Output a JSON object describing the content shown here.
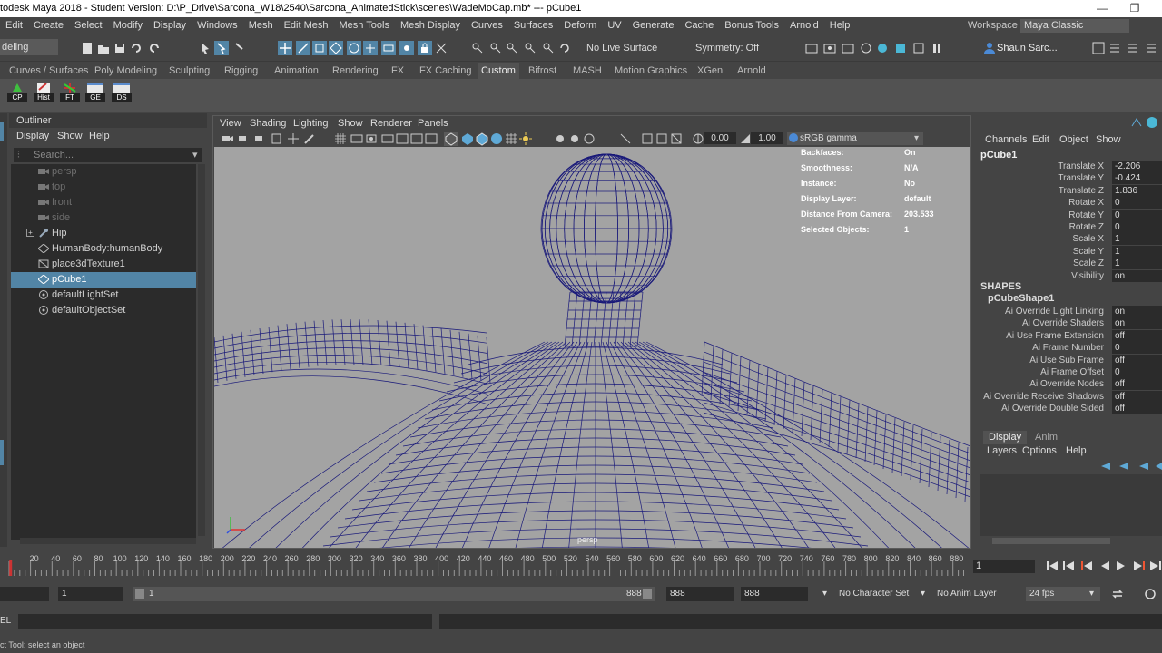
{
  "title_bar": {
    "text": "todesk Maya 2018 - Student Version: D:\\P_Drive\\Sarcona_W18\\2540\\Sarcona_AnimatedStick\\scenes\\WadeMoCap.mb*   ---   pCube1",
    "minimize_glyph": "—",
    "restore_glyph": "❐"
  },
  "menu_bar": {
    "items": [
      "Edit",
      "Create",
      "Select",
      "Modify",
      "Display",
      "Windows",
      "Mesh",
      "Edit Mesh",
      "Mesh Tools",
      "Mesh Display",
      "Curves",
      "Surfaces",
      "Deform",
      "UV",
      "Generate",
      "Cache",
      "Bonus Tools",
      "Arnold",
      "Help"
    ],
    "workspace_label": "Workspace :",
    "workspace_value": "Maya Classic"
  },
  "status_line": {
    "mode": "deling",
    "live_surface": "No Live Surface",
    "symmetry": "Symmetry: Off",
    "user": "Shaun Sarc..."
  },
  "shelf_tabs": {
    "items": [
      "Curves / Surfaces",
      "Poly Modeling",
      "Sculpting",
      "Rigging",
      "Animation",
      "Rendering",
      "FX",
      "FX Caching",
      "Custom",
      "Bifrost",
      "MASH",
      "Motion Graphics",
      "XGen",
      "Arnold"
    ],
    "active": "Custom"
  },
  "shelf_buttons": [
    {
      "label": "CP",
      "icon": "cp-shelf-icon"
    },
    {
      "label": "Hist",
      "icon": "history-shelf-icon"
    },
    {
      "label": "FT",
      "icon": "freeze-transform-shelf-icon"
    },
    {
      "label": "GE",
      "icon": "graph-editor-shelf-icon"
    },
    {
      "label": "DS",
      "icon": "dope-sheet-shelf-icon"
    }
  ],
  "outliner": {
    "title": "Outliner",
    "menus": [
      "Display",
      "Show",
      "Help"
    ],
    "search_placeholder": "Search...",
    "items": [
      {
        "label": "persp",
        "icon": "camera-icon",
        "dim": true
      },
      {
        "label": "top",
        "icon": "camera-icon",
        "dim": true
      },
      {
        "label": "front",
        "icon": "camera-icon",
        "dim": true
      },
      {
        "label": "side",
        "icon": "camera-icon",
        "dim": true
      },
      {
        "label": "Hip",
        "icon": "joint-icon",
        "dim": false,
        "expandable": true
      },
      {
        "label": "HumanBody:humanBody",
        "icon": "mesh-icon",
        "dim": false
      },
      {
        "label": "place3dTexture1",
        "icon": "texture-placement-icon",
        "dim": false
      },
      {
        "label": "pCube1",
        "icon": "mesh-icon",
        "dim": false,
        "selected": true
      },
      {
        "label": "defaultLightSet",
        "icon": "set-icon",
        "dim": false
      },
      {
        "label": "defaultObjectSet",
        "icon": "set-icon",
        "dim": false
      }
    ]
  },
  "viewport": {
    "menus": [
      "View",
      "Shading",
      "Lighting",
      "Show",
      "Renderer",
      "Panels"
    ],
    "exposure": "0.00",
    "gamma": "1.00",
    "color_space": "sRGB gamma",
    "camera_label": "persp",
    "hud": [
      {
        "label": "Backfaces:",
        "value": "On"
      },
      {
        "label": "Smoothness:",
        "value": "N/A"
      },
      {
        "label": "Instance:",
        "value": "No"
      },
      {
        "label": "Display Layer:",
        "value": "default"
      },
      {
        "label": "Distance From Camera:",
        "value": "203.533"
      },
      {
        "label": "Selected Objects:",
        "value": "1"
      }
    ],
    "wire_color": "#1a1a7a",
    "background_color": "#a3a3a3"
  },
  "channel_box": {
    "menus": [
      "Channels",
      "Edit",
      "Object",
      "Show"
    ],
    "object": "pCube1",
    "attributes": [
      {
        "name": "Translate X",
        "value": "-2.206"
      },
      {
        "name": "Translate Y",
        "value": "-0.424"
      },
      {
        "name": "Translate Z",
        "value": "1.836"
      },
      {
        "name": "Rotate X",
        "value": "0"
      },
      {
        "name": "Rotate Y",
        "value": "0"
      },
      {
        "name": "Rotate Z",
        "value": "0"
      },
      {
        "name": "Scale X",
        "value": "1"
      },
      {
        "name": "Scale Y",
        "value": "1"
      },
      {
        "name": "Scale Z",
        "value": "1"
      },
      {
        "name": "Visibility",
        "value": "on"
      }
    ],
    "shapes_header": "SHAPES",
    "shape_name": "pCubeShape1",
    "shape_attributes": [
      {
        "name": "Ai Override Light Linking",
        "value": "on"
      },
      {
        "name": "Ai Override Shaders",
        "value": "on"
      },
      {
        "name": "Ai Use Frame Extension",
        "value": "off"
      },
      {
        "name": "Ai Frame Number",
        "value": "0"
      },
      {
        "name": "Ai Use Sub Frame",
        "value": "off"
      },
      {
        "name": "Ai Frame Offset",
        "value": "0"
      },
      {
        "name": "Ai Override Nodes",
        "value": "off"
      },
      {
        "name": "Ai Override Receive Shadows",
        "value": "off"
      },
      {
        "name": "Ai Override Double Sided",
        "value": "off"
      }
    ]
  },
  "layer_editor": {
    "tabs": [
      "Display",
      "Anim"
    ],
    "active_tab": "Display",
    "menus": [
      "Layers",
      "Options",
      "Help"
    ]
  },
  "time_slider": {
    "ticks": [
      "20",
      "40",
      "60",
      "80",
      "100",
      "120",
      "140",
      "160",
      "180",
      "200",
      "220",
      "240",
      "260",
      "280",
      "300",
      "320",
      "340",
      "360",
      "380",
      "400",
      "420",
      "440",
      "460",
      "480",
      "500",
      "520",
      "540",
      "560",
      "580",
      "600",
      "620",
      "640",
      "660",
      "680",
      "700",
      "720",
      "740",
      "760",
      "780",
      "800",
      "820",
      "840",
      "860",
      "880"
    ],
    "current_frame": "1"
  },
  "range_slider": {
    "start_frame": "1",
    "range_start": "1",
    "range_end": "888",
    "anim_end": "888",
    "playback_end": "888",
    "character_set": "No Character Set",
    "anim_layer": "No Anim Layer",
    "fps": "24 fps"
  },
  "command_line": {
    "label": "EL"
  },
  "help_line": {
    "text": "ct Tool: select an object"
  }
}
